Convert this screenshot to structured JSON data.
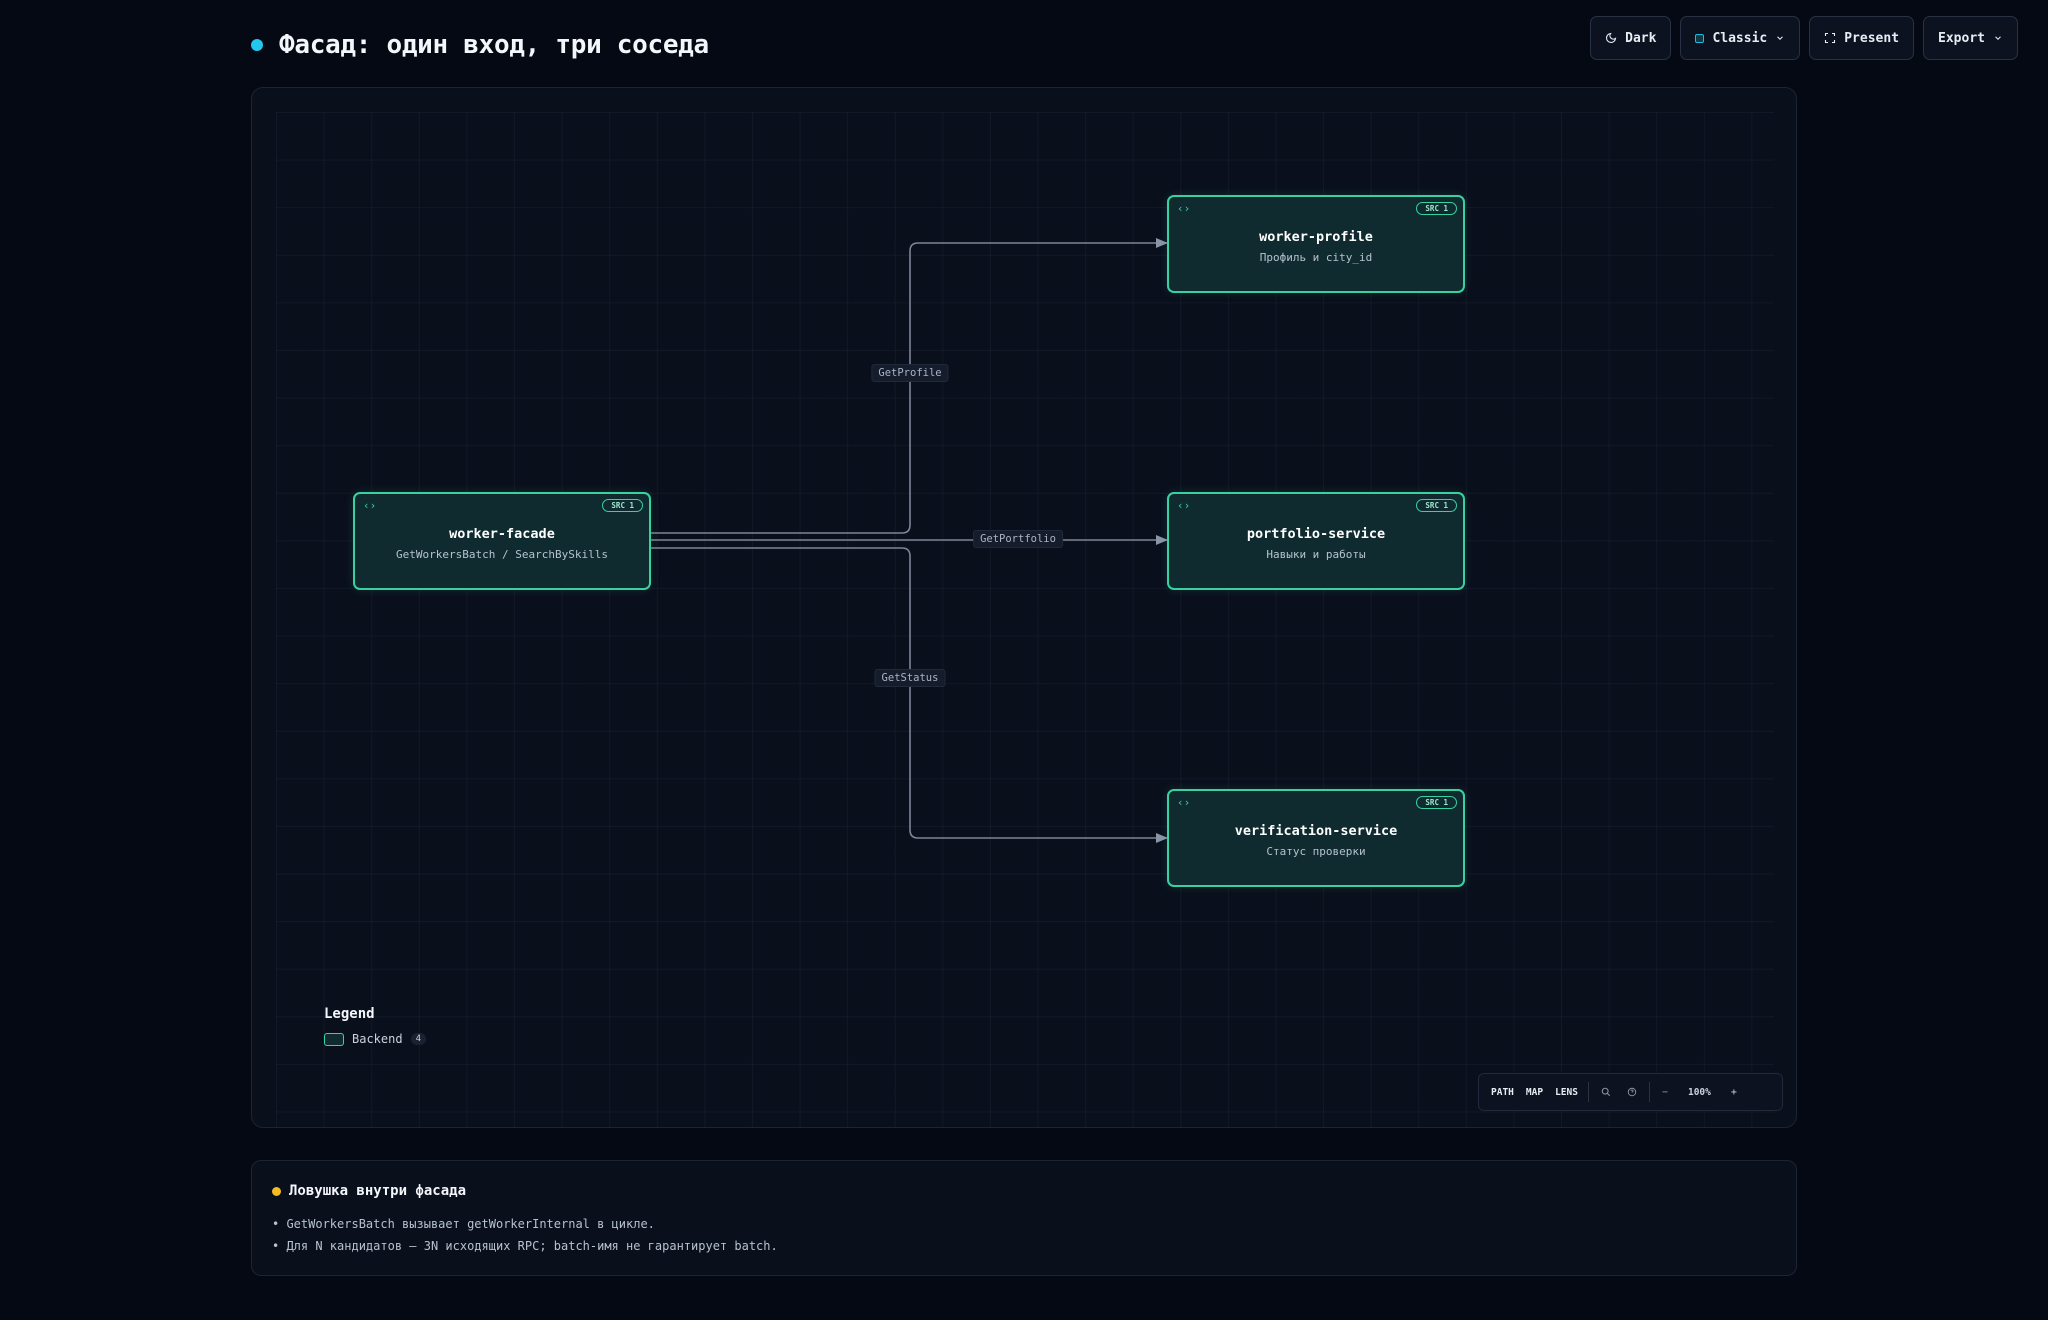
{
  "header": {
    "title": "Фасад: один вход, три соседа",
    "accent": "#22c7ee"
  },
  "toolbar": {
    "dark_label": "Dark",
    "classic_label": "Classic",
    "present_label": "Present",
    "export_label": "Export"
  },
  "diagram": {
    "nodes": [
      {
        "id": "worker-facade",
        "title": "worker-facade",
        "subtitle": "GetWorkersBatch / SearchBySkills",
        "badge": "SRC 1",
        "icon": "code-brackets-icon"
      },
      {
        "id": "worker-profile",
        "title": "worker-profile",
        "subtitle": "Профиль и city_id",
        "badge": "SRC 1",
        "icon": "code-brackets-icon"
      },
      {
        "id": "portfolio-service",
        "title": "portfolio-service",
        "subtitle": "Навыки и работы",
        "badge": "SRC 1",
        "icon": "code-brackets-icon"
      },
      {
        "id": "verification-service",
        "title": "verification-service",
        "subtitle": "Статус проверки",
        "badge": "SRC 1",
        "icon": "code-brackets-icon"
      }
    ],
    "edges": [
      {
        "from": "worker-facade",
        "to": "worker-profile",
        "label": "GetProfile"
      },
      {
        "from": "worker-facade",
        "to": "portfolio-service",
        "label": "GetPortfolio"
      },
      {
        "from": "worker-facade",
        "to": "verification-service",
        "label": "GetStatus"
      }
    ],
    "node_color": "#3ad1a0",
    "edge_color": "#7c8696"
  },
  "legend": {
    "title": "Legend",
    "items": [
      {
        "label": "Backend",
        "count": "4"
      }
    ]
  },
  "controls": {
    "path": "PATH",
    "map": "MAP",
    "lens": "LENS",
    "zoom": "100%",
    "minus": "−",
    "plus": "+"
  },
  "note": {
    "title": "Ловушка внутри фасада",
    "accent": "#f5b922",
    "items": [
      "GetWorkersBatch вызывает getWorkerInternal в цикле.",
      "Для N кандидатов — 3N исходящих RPC; batch-имя не гарантирует batch."
    ]
  }
}
